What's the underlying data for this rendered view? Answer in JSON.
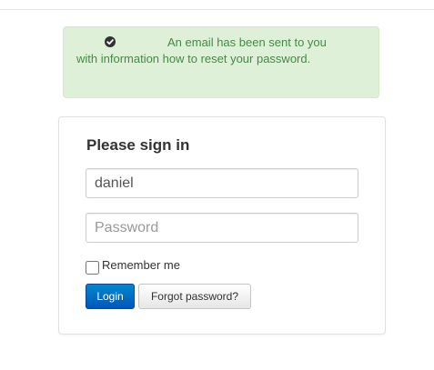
{
  "alert": {
    "icon": "check-circle-icon",
    "message": "An email has been sent to you with information how to reset your password."
  },
  "form": {
    "title": "Please sign in",
    "username_value": "daniel",
    "password_placeholder": "Password",
    "remember_label": "Remember me",
    "login_label": "Login",
    "forgot_label": "Forgot password?"
  },
  "colors": {
    "alert_bg": "#dff0d8",
    "alert_text": "#468847",
    "primary": "#0066cc"
  }
}
